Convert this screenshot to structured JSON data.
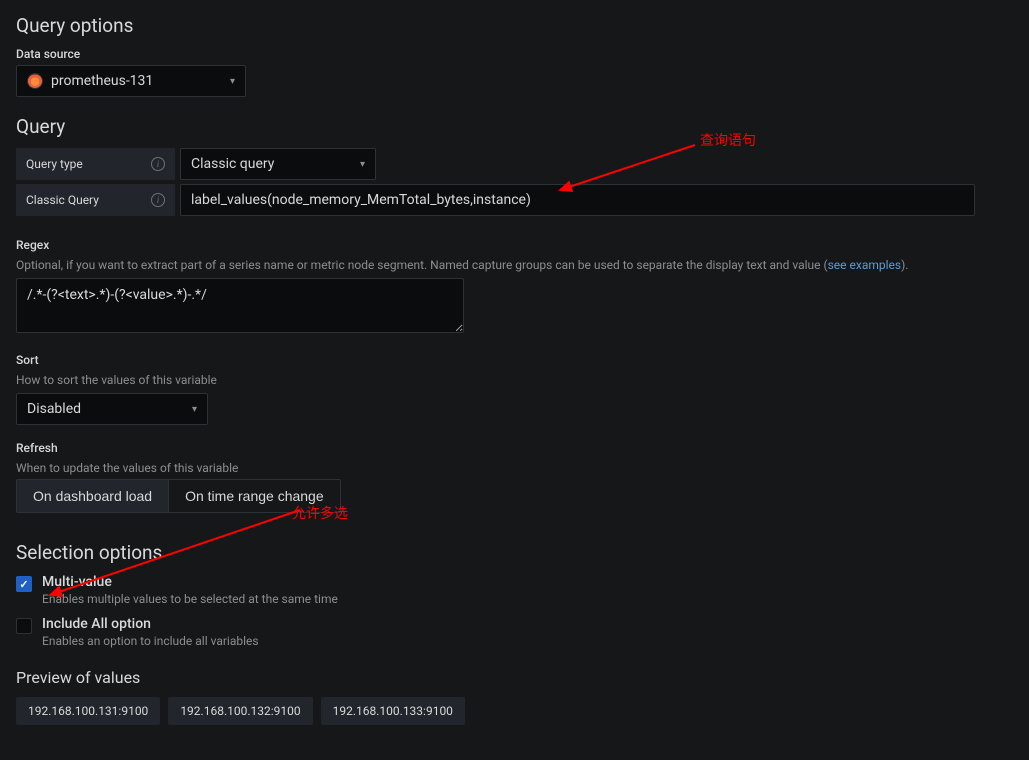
{
  "headings": {
    "queryOptions": "Query options",
    "query": "Query",
    "selectionOptions": "Selection options",
    "previewOfValues": "Preview of values"
  },
  "dataSource": {
    "label": "Data source",
    "value": "prometheus-131"
  },
  "queryType": {
    "label": "Query type",
    "value": "Classic query"
  },
  "classicQuery": {
    "label": "Classic Query",
    "value": "label_values(node_memory_MemTotal_bytes,instance)"
  },
  "regex": {
    "label": "Regex",
    "hintPrefix": "Optional, if you want to extract part of a series name or metric node segment. Named capture groups can be used to separate the display text and value (",
    "hintLink": "see examples",
    "hintSuffix": ").",
    "value": "/.*-(?<text>.*)-(?<value>.*)-.*/"
  },
  "sort": {
    "label": "Sort",
    "hint": "How to sort the values of this variable",
    "value": "Disabled"
  },
  "refresh": {
    "label": "Refresh",
    "hint": "When to update the values of this variable",
    "options": [
      "On dashboard load",
      "On time range change"
    ],
    "active": 0
  },
  "multiValue": {
    "label": "Multi-value",
    "desc": "Enables multiple values to be selected at the same time",
    "checked": true
  },
  "includeAll": {
    "label": "Include All option",
    "desc": "Enables an option to include all variables",
    "checked": false
  },
  "previewValues": [
    "192.168.100.131:9100",
    "192.168.100.132:9100",
    "192.168.100.133:9100"
  ],
  "annotations": {
    "queryLabel": "查询语句",
    "multiSelectLabel": "允许多选"
  }
}
